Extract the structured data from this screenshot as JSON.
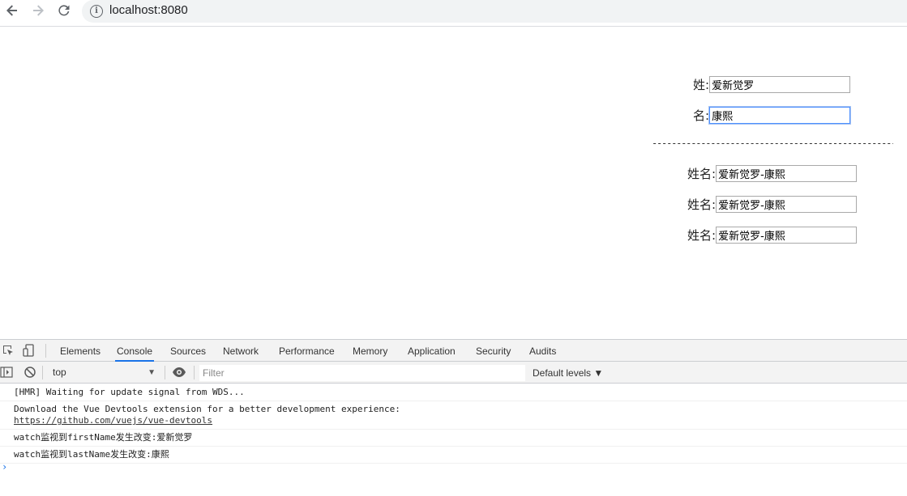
{
  "browser": {
    "url": "localhost:8080"
  },
  "form": {
    "first_name": {
      "label": "姓:",
      "value": "爱新觉罗"
    },
    "last_name": {
      "label": "名:",
      "value": "康熙"
    },
    "divider": "-----------------------------------------------------------------------------",
    "full_names": [
      {
        "label": "姓名:",
        "value": "爱新觉罗-康熙"
      },
      {
        "label": "姓名:",
        "value": "爱新觉罗-康熙"
      },
      {
        "label": "姓名:",
        "value": "爱新觉罗-康熙"
      }
    ]
  },
  "devtools": {
    "tabs": [
      "Elements",
      "Console",
      "Sources",
      "Network",
      "Performance",
      "Memory",
      "Application",
      "Security",
      "Audits"
    ],
    "active_tab": "Console",
    "context": "top",
    "filter_placeholder": "Filter",
    "levels_label": "Default levels ▼",
    "console_lines": [
      "[HMR] Waiting for update signal from WDS...",
      "Download the Vue Devtools extension for a better development experience:",
      "https://github.com/vuejs/vue-devtools",
      "watch监视到firstName发生改变:爱新觉罗",
      "watch监视到lastName发生改变:康熙"
    ],
    "prompt": "›"
  },
  "icons": {
    "back": "back-arrow-icon",
    "forward": "forward-arrow-icon",
    "reload": "reload-icon",
    "info": "info-icon",
    "inspect": "inspect-element-icon",
    "device": "device-toolbar-icon",
    "sidebar": "console-sidebar-icon",
    "clear": "clear-console-icon",
    "eye": "live-expression-icon"
  },
  "colors": {
    "accent": "#1a73e8",
    "focus_border": "#4d90fe"
  }
}
